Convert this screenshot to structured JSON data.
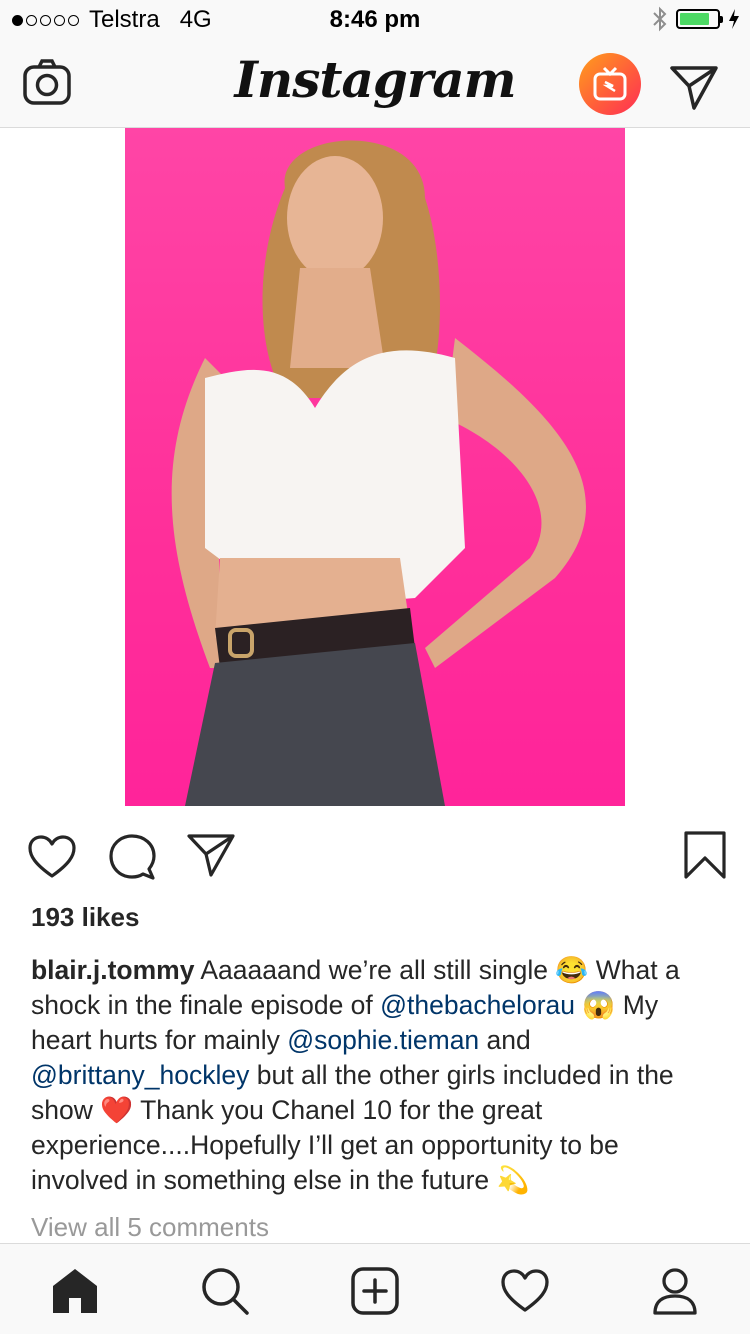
{
  "status_bar": {
    "carrier": "Telstra",
    "network": "4G",
    "time": "8:46 pm",
    "signal_bars_filled": 1,
    "signal_bars_total": 5,
    "battery_level": 0.8,
    "battery_color": "#4cd964"
  },
  "header": {
    "logo": "Instagram",
    "igtv_gradient": [
      "#ff9f1c",
      "#ff2d55"
    ],
    "icons": [
      "camera-icon",
      "igtv-icon",
      "direct-message-icon"
    ]
  },
  "post": {
    "photo_background": "#ff2f9a",
    "actions": [
      "heart-icon",
      "comment-icon",
      "share-icon",
      "bookmark-icon"
    ],
    "likes": "193 likes",
    "caption": {
      "username": "blair.j.tommy",
      "text_1": " Aaaaaand we’re all still single 😂  What a shock in the finale episode of ",
      "mention_1": "@thebachelorau",
      "text_2": " 😱 My heart hurts for mainly ",
      "mention_2": "@sophie.tieman",
      "text_3": " and ",
      "mention_3": "@brittany_hockley",
      "text_4": " but all the other girls included in the show ❤️  Thank you Chanel 10 for the great experience....Hopefully I’ll get an opportunity to be involved in something else in the future 💫"
    },
    "view_comments": "View all 5 comments"
  },
  "tab_bar": {
    "tabs": [
      "home-icon",
      "search-icon",
      "new-post-icon",
      "activity-icon",
      "profile-icon"
    ],
    "active": "home-icon"
  }
}
